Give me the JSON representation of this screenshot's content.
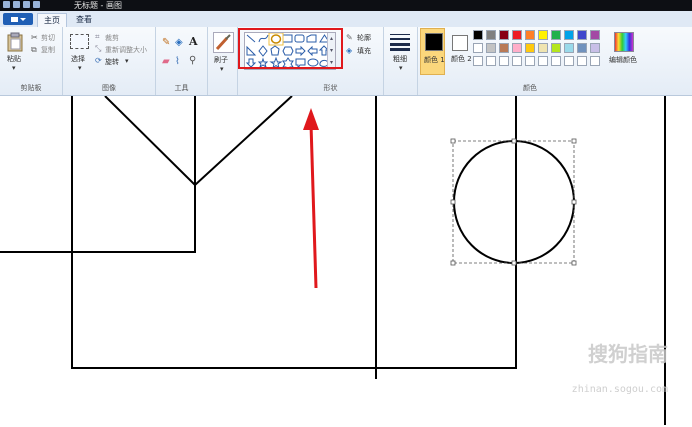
{
  "window": {
    "title": "无标题 - 画图"
  },
  "tabs": [
    {
      "label": "主页",
      "active": true
    },
    {
      "label": "查看",
      "active": false
    }
  ],
  "groups": {
    "clipboard": {
      "label": "剪贴板",
      "paste": "粘贴",
      "cut": "剪切",
      "copy": "复制"
    },
    "image": {
      "label": "图像",
      "select": "选择",
      "crop": "裁剪",
      "resize": "重新调整大小",
      "rotate": "旋转"
    },
    "tools": {
      "label": "工具"
    },
    "brushes": {
      "label": "刷子"
    },
    "shapes": {
      "label": "形状",
      "outline": "轮廓",
      "fill": "填充"
    },
    "size": {
      "label": "粗细"
    },
    "colors": {
      "label": "颜色",
      "color1": "颜色 1",
      "color2": "颜色 2",
      "edit": "编辑颜色",
      "color1_value": "#000000",
      "color2_value": "#ffffff",
      "palette_row1": [
        "#000000",
        "#7f7f7f",
        "#880015",
        "#ed1c24",
        "#ff7f27",
        "#fff200",
        "#22b14c",
        "#00a2e8",
        "#3f48cc",
        "#a349a4"
      ],
      "palette_row2": [
        "#ffffff",
        "#c3c3c3",
        "#b97a57",
        "#ffaec9",
        "#ffc90e",
        "#efe4b0",
        "#b5e61d",
        "#99d9ea",
        "#7092be",
        "#c8bfe7"
      ]
    }
  },
  "annotation": {
    "highlight_color": "#e0181c"
  },
  "watermark": {
    "line1": "搜狗指南",
    "line2": "zhinan.sogou.com"
  }
}
